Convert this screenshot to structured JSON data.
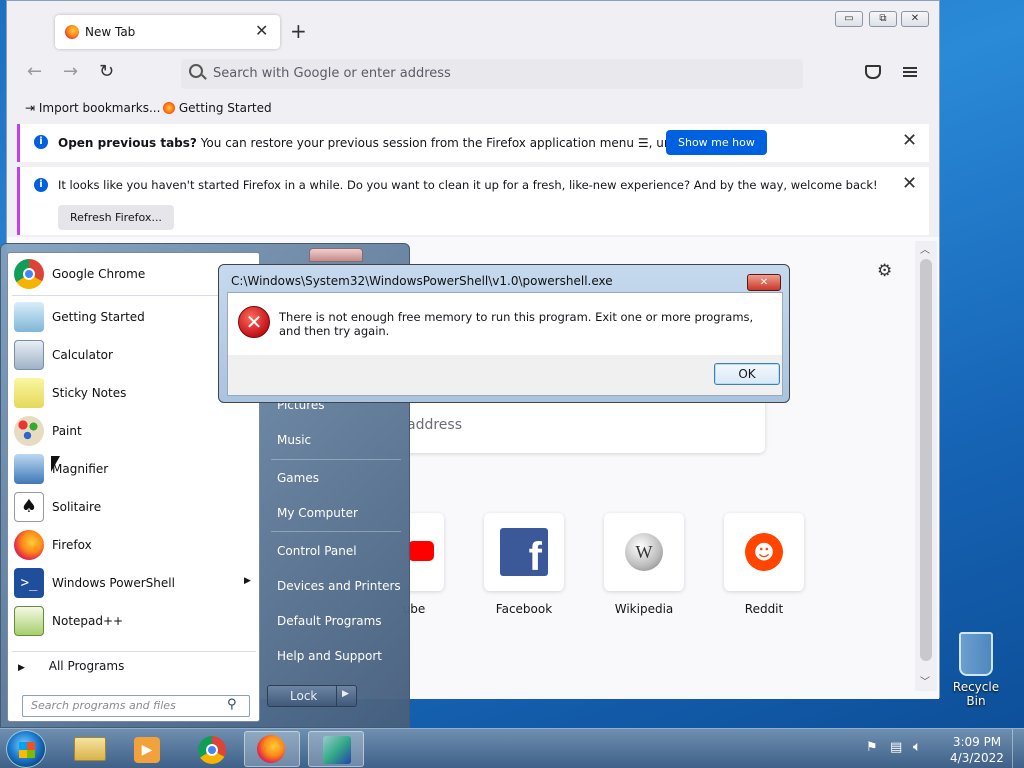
{
  "browser": {
    "tab_title": "New Tab",
    "new_tab_symbol": "+",
    "tab_close_symbol": "✕",
    "window_buttons": [
      "▭",
      "⧉",
      "✕"
    ],
    "url_placeholder": "Search with Google or enter address",
    "bookmarks": [
      "Import bookmarks...",
      "Getting Started"
    ],
    "notification1": {
      "text_bold": "Open previous tabs?",
      "text": " You can restore your previous session from the Firefox application menu",
      "text_after": ", under History.",
      "button": "Show me how"
    },
    "notification2": {
      "text": "It looks like you haven't started Firefox in a while. Do you want to clean it up for a fresh, like-new experience? And by the way, welcome back!",
      "button": "Refresh Firefox..."
    },
    "search_partial": "address",
    "tiles": [
      {
        "label": "ube",
        "icon": "youtube-icon"
      },
      {
        "label": "Facebook",
        "icon": "facebook-icon"
      },
      {
        "label": "Wikipedia",
        "icon": "wikipedia-icon"
      },
      {
        "label": "Reddit",
        "icon": "reddit-icon"
      }
    ]
  },
  "start_menu": {
    "programs": [
      {
        "label": "Google Chrome",
        "icon": "chrome-icon"
      },
      {
        "label": "Getting Started",
        "icon": "getting-started-icon"
      },
      {
        "label": "Calculator",
        "icon": "calculator-icon"
      },
      {
        "label": "Sticky Notes",
        "icon": "sticky-notes-icon"
      },
      {
        "label": "Paint",
        "icon": "paint-icon"
      },
      {
        "label": "Magnifier",
        "icon": "magnifier-icon"
      },
      {
        "label": "Solitaire",
        "icon": "solitaire-icon"
      },
      {
        "label": "Firefox",
        "icon": "firefox-icon"
      },
      {
        "label": "Windows PowerShell",
        "icon": "powershell-icon"
      },
      {
        "label": "Notepad++",
        "icon": "notepadpp-icon"
      }
    ],
    "all_programs": "All Programs",
    "search_placeholder": "Search programs and files",
    "right_items": [
      "Pictures",
      "Music",
      "Games",
      "My Computer",
      "Control Panel",
      "Devices and Printers",
      "Default Programs",
      "Help and Support"
    ],
    "lock_label": "Lock"
  },
  "dialog": {
    "title": "C:\\Windows\\System32\\WindowsPowerShell\\v1.0\\powershell.exe",
    "message": "There is not enough free memory to run this program. Exit one or more programs, and then try again.",
    "ok": "OK",
    "close_symbol": "✕"
  },
  "desktop": {
    "recycle_bin": "Recycle Bin"
  },
  "taskbar": {
    "time": "3:09 PM",
    "date": "4/3/2022"
  }
}
